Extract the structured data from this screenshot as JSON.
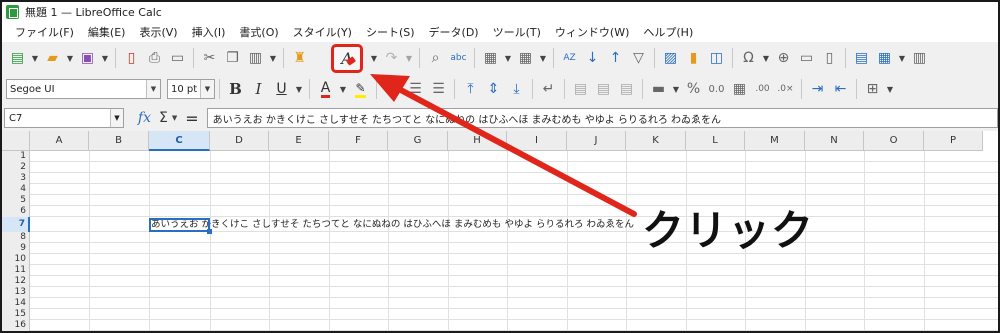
{
  "window": {
    "title": "無題 1 — LibreOffice Calc"
  },
  "menu": [
    "ファイル(F)",
    "編集(E)",
    "表示(V)",
    "挿入(I)",
    "書式(O)",
    "スタイル(Y)",
    "シート(S)",
    "データ(D)",
    "ツール(T)",
    "ウィンドウ(W)",
    "ヘルプ(H)"
  ],
  "formatting": {
    "font_name": "Segoe UI",
    "font_size": "10 pt",
    "bold": "B",
    "italic": "I",
    "underline": "U",
    "font_color": "A"
  },
  "formula_bar": {
    "name_box": "C7",
    "fx": "fx",
    "sigma": "Σ",
    "equals": "=",
    "content": "あいうえお かきくけこ さしすせそ たちつてと なにぬねの はひふへほ まみむめも やゆよ らりるれろ わゐゑをん"
  },
  "columns": [
    "A",
    "B",
    "C",
    "D",
    "E",
    "F",
    "G",
    "H",
    "I",
    "J",
    "K",
    "L",
    "M",
    "N",
    "O",
    "P"
  ],
  "rows": [
    "1",
    "2",
    "3",
    "4",
    "5",
    "6",
    "7",
    "8",
    "9",
    "10",
    "11",
    "12",
    "13",
    "14",
    "15",
    "16"
  ],
  "active_cell": {
    "column": "C",
    "row": "7",
    "text": "あいうえお かきくけこ さしすせそ たちつてと なにぬねの はひふへほ まみむめも やゆよ らりるれろ わゐゑをん"
  },
  "annotation": {
    "text": "クリック",
    "color": "#e0261b"
  },
  "colors": {
    "accent": "#2a6fbf",
    "highlight_box": "#e0261b",
    "app_green": "#2e9b3e"
  },
  "icons": {
    "toolbar1": [
      "new-spreadsheet-icon",
      "open-folder-icon",
      "save-icon",
      "export-pdf-icon",
      "print-icon",
      "print-preview-icon",
      "cut-icon",
      "copy-icon",
      "paste-icon",
      "clone-formatting-icon",
      "clear-direct-formatting-icon",
      "undo-icon",
      "redo-icon",
      "find-replace-icon",
      "spelling-icon",
      "row-icon",
      "column-icon",
      "sort-icon",
      "sort-ascending-icon",
      "sort-descending-icon",
      "autofilter-icon",
      "image-icon",
      "chart-icon",
      "pivot-table-icon",
      "special-character-icon",
      "hyperlink-icon",
      "comment-icon",
      "header-footer-icon",
      "define-print-area-icon",
      "freeze-rows-columns-icon",
      "split-window-icon"
    ],
    "toolbar2": [
      "align-left-icon",
      "align-center-icon",
      "align-right-icon",
      "align-top-icon",
      "align-center-vertical-icon",
      "align-bottom-icon",
      "wrap-text-icon",
      "merge-center-icon",
      "merge-cells-icon",
      "unmerge-cells-icon",
      "currency-format-icon",
      "percent-format-icon",
      "number-format-icon",
      "date-format-icon",
      "add-decimal-icon",
      "delete-decimal-icon",
      "increase-indent-icon",
      "decrease-indent-icon",
      "borders-icon"
    ]
  }
}
